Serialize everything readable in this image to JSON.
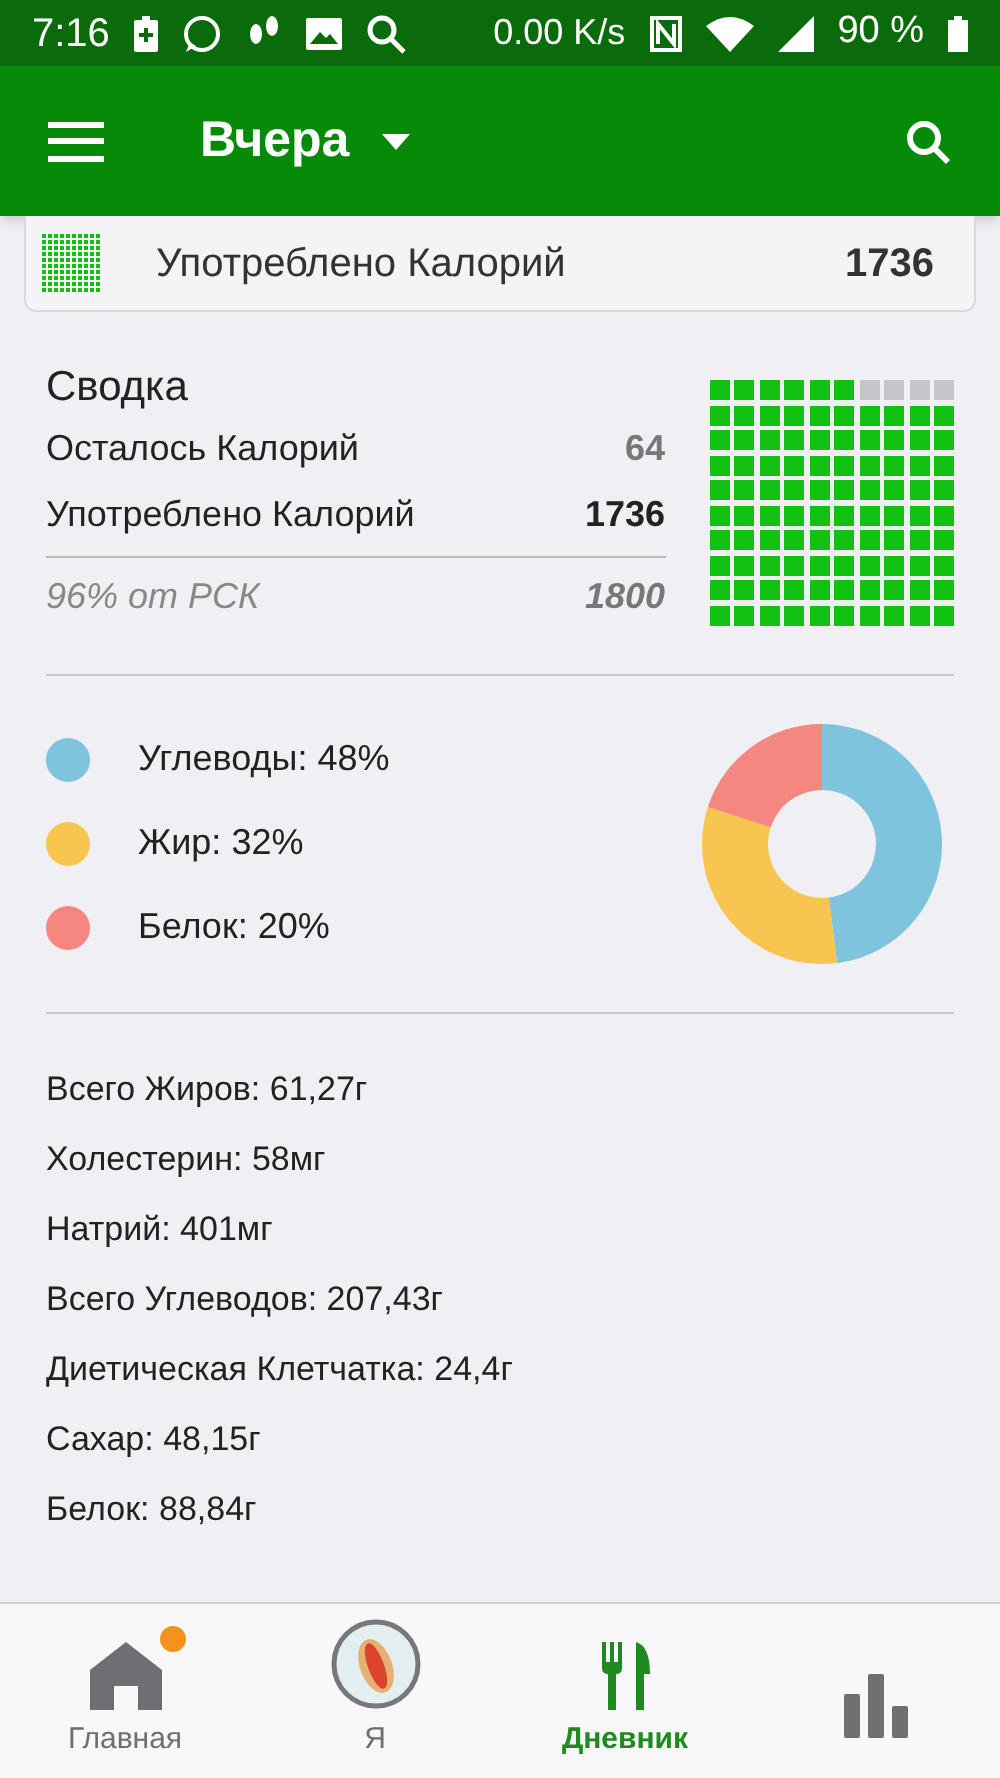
{
  "status_bar": {
    "time": "7:16",
    "speed": "0.00 K/s",
    "battery": "90 %"
  },
  "app_bar": {
    "title": "Вчера"
  },
  "previous_card": {
    "label": "Употреблено Калорий",
    "value": "1736"
  },
  "summary": {
    "title": "Сводка",
    "rows": [
      {
        "label": "Осталось Калорий",
        "value": "64",
        "bold": false
      },
      {
        "label": "Употреблено Калорий",
        "value": "1736",
        "bold": true
      }
    ],
    "goal_label": "96% от РСК",
    "goal_value": "1800"
  },
  "macros": {
    "items": [
      {
        "label": "Углеводы: 48%",
        "color": "#7ec4dd"
      },
      {
        "label": "Жир: 32%",
        "color": "#f8c54e"
      },
      {
        "label": "Белок: 20%",
        "color": "#f4877f"
      }
    ],
    "chart_data": {
      "type": "donut",
      "values": [
        48,
        32,
        20
      ]
    }
  },
  "nutrients": [
    "Всего Жиров: 61,27г",
    "Холестерин: 58мг",
    "Натрий: 401мг",
    "Всего Углеводов: 207,43г",
    "Диетическая Клетчатка: 24,4г",
    "Сахар: 48,15г",
    "Белок: 88,84г"
  ],
  "bottom_nav": [
    {
      "kind": "home",
      "label": "Главная",
      "selected": false,
      "badge": true
    },
    {
      "kind": "me",
      "label": "Я",
      "selected": false,
      "badge": false
    },
    {
      "kind": "diary",
      "label": "Дневник",
      "selected": true,
      "badge": false
    },
    {
      "kind": "reports",
      "selected": false,
      "badge": false
    }
  ]
}
